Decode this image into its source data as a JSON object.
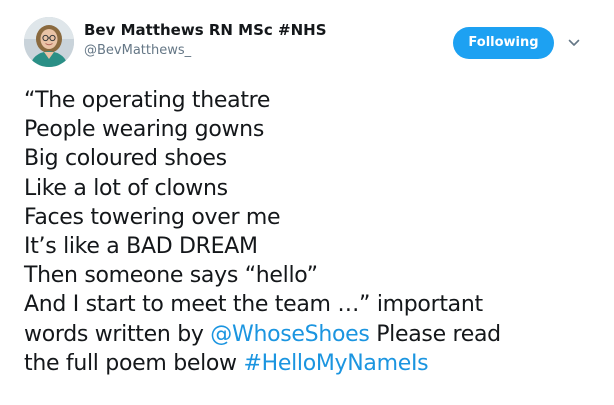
{
  "author": {
    "display_name": "Bev Matthews RN MSc #NHS",
    "handle": "@BevMatthews_"
  },
  "follow_button": {
    "label": "Following"
  },
  "colors": {
    "accent": "#1da1f2",
    "link": "#1b95e0",
    "text": "#14171a",
    "secondary_text": "#657786"
  },
  "icons": {
    "menu": "chevron-down-icon"
  },
  "tweet": {
    "lines": [
      "“The operating theatre",
      "People wearing gowns",
      "Big coloured shoes",
      "Like a lot of clowns",
      "Faces towering over me",
      "It’s like a BAD DREAM",
      "Then someone says “hello”",
      "And I start to meet the team …” important"
    ],
    "line9_prefix": "words written by ",
    "mention": "@WhoseShoes",
    "line9_suffix": " Please read",
    "line10_prefix": "the full poem below ",
    "hashtag": "#HelloMyNameIs"
  }
}
